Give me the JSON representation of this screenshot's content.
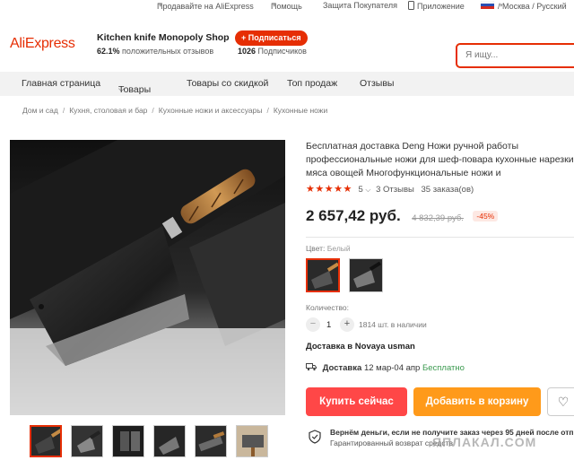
{
  "topbar": {
    "sell": "Продавайте на AliExpress",
    "help": "Помощь",
    "protection": "Защита Покупателя",
    "app": "Приложение",
    "region": "/ Москва / Русский"
  },
  "header": {
    "logo": "AliExpress",
    "store_name": "Kitchen knife Monopoly Shop",
    "positive_pct": "62.1%",
    "positive_label": "положительных отзывов",
    "subscribers_count": "1026",
    "subscribers_label": "Подписчиков",
    "subscribe_label": "+ Подписаться",
    "search_placeholder": "Я ищу..."
  },
  "nav": {
    "items": [
      "Главная страница",
      "Товары",
      "Товары со скидкой",
      "Топ продаж",
      "Отзывы"
    ]
  },
  "breadcrumb": [
    "Дом и сад",
    "Кухня, столовая и бар",
    "Кухонные ножи и аксессуары",
    "Кухонные ножи"
  ],
  "product": {
    "title": "Бесплатная доставка Deng Ножи ручной работы профессиональные ножи для шеф-повара кухонные нарезки мяса овощей Многофункциональные ножи и",
    "stars": "★★★★★",
    "rating": "5",
    "reviews": "3 Отзывы",
    "orders": "35 заказа(ов)",
    "price": "2 657,42 руб.",
    "old_price": "4 832,39 руб.",
    "discount": "-45%",
    "color_label": "Цвет:",
    "color_value": "Белый",
    "qty_label": "Количество:",
    "qty_minus": "−",
    "qty_value": "1",
    "qty_plus": "+",
    "stock": "1814 шт. в наличии",
    "ship_to": "Доставка в Novaya usman",
    "delivery_label": "Доставка",
    "delivery_dates": "12 мар-04 апр",
    "delivery_free": "Бесплатно",
    "buy_now": "Купить сейчас",
    "add_to_cart": "Добавить в корзину",
    "guarantee_title": "Вернём деньги, если не получите заказ через 95 дней после отпр",
    "guarantee_sub": "Гарантированный возврат средств"
  },
  "watermark": "ЯПЛАКАЛ.COM",
  "colors": {
    "brand": "#e62e04",
    "buy": "#ff4747",
    "cart": "#ff9a1a",
    "free": "#3b9a4f",
    "nav_bg": "#f2f2f2"
  },
  "icons": [
    "chevron-down-icon",
    "phone-icon",
    "flag-icon",
    "truck-icon",
    "heart-icon",
    "shield-icon"
  ]
}
